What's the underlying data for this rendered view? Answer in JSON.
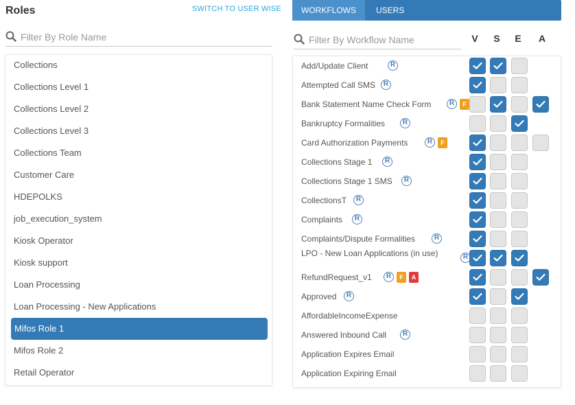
{
  "roles_panel": {
    "title": "Roles",
    "switch_label": "SWITCH TO USER WISE",
    "filter_placeholder": "Filter By Role Name",
    "items": [
      {
        "label": "Collections",
        "selected": false
      },
      {
        "label": "Collections Level 1",
        "selected": false
      },
      {
        "label": "Collections Level 2",
        "selected": false
      },
      {
        "label": "Collections Level 3",
        "selected": false
      },
      {
        "label": "Collections Team",
        "selected": false
      },
      {
        "label": "Customer Care",
        "selected": false
      },
      {
        "label": "HDEPOLKS",
        "selected": false
      },
      {
        "label": "job_execution_system",
        "selected": false
      },
      {
        "label": "Kiosk Operator",
        "selected": false
      },
      {
        "label": "Kiosk support",
        "selected": false
      },
      {
        "label": "Loan Processing",
        "selected": false
      },
      {
        "label": "Loan Processing - New Applications",
        "selected": false
      },
      {
        "label": "Mifos Role 1",
        "selected": true
      },
      {
        "label": "Mifos Role 2",
        "selected": false
      },
      {
        "label": "Retail Operator",
        "selected": false
      }
    ]
  },
  "workflow_panel": {
    "tabs": [
      {
        "label": "WORKFLOWS",
        "active": true
      },
      {
        "label": "USERS",
        "active": false
      }
    ],
    "filter_placeholder": "Filter By Workflow Name",
    "columns": [
      "V",
      "S",
      "E",
      "A"
    ],
    "r_icon_label": "R",
    "badge_f_label": "F",
    "badge_a_label": "A",
    "colors": {
      "accent": "#337ab7",
      "badge_f": "#f0a020",
      "badge_a": "#e03c3c"
    },
    "rows": [
      {
        "name": "Add/Update Client",
        "r": true,
        "badges": [],
        "checks": [
          true,
          true,
          false
        ],
        "a": null
      },
      {
        "name": "Attempted Call SMS",
        "r": true,
        "badges": [],
        "checks": [
          true,
          false,
          false
        ],
        "a": null
      },
      {
        "name": "Bank Statement Name Check Form",
        "r": true,
        "badges": [
          "F"
        ],
        "checks": [
          false,
          true,
          false
        ],
        "a": true
      },
      {
        "name": "Bankruptcy Formalities",
        "r": true,
        "badges": [],
        "checks": [
          false,
          false,
          true
        ],
        "a": null
      },
      {
        "name": "Card Authorization Payments",
        "r": true,
        "badges": [
          "F"
        ],
        "checks": [
          true,
          false,
          false
        ],
        "a": false
      },
      {
        "name": "Collections Stage 1",
        "r": true,
        "badges": [],
        "checks": [
          true,
          false,
          false
        ],
        "a": null
      },
      {
        "name": "Collections Stage 1 SMS",
        "r": true,
        "badges": [],
        "checks": [
          true,
          false,
          false
        ],
        "a": null
      },
      {
        "name": "CollectionsT",
        "r": true,
        "badges": [],
        "checks": [
          true,
          false,
          false
        ],
        "a": null
      },
      {
        "name": "Complaints",
        "r": true,
        "badges": [],
        "checks": [
          true,
          false,
          false
        ],
        "a": null
      },
      {
        "name": "Complaints/Dispute Formalities",
        "r": true,
        "badges": [],
        "checks": [
          true,
          false,
          false
        ],
        "a": null
      },
      {
        "name": "LPO - New Loan Applications (in use)",
        "r": true,
        "badges": [],
        "checks": [
          true,
          true,
          true
        ],
        "a": null
      },
      {
        "name": "RefundRequest_v1",
        "r": true,
        "badges": [
          "F",
          "A"
        ],
        "checks": [
          true,
          false,
          false
        ],
        "a": true
      },
      {
        "name": "Approved",
        "r": true,
        "badges": [],
        "checks": [
          true,
          false,
          true
        ],
        "a": null
      },
      {
        "name": "AffordableIncomeExpense",
        "r": false,
        "badges": [],
        "checks": [
          false,
          false,
          false
        ],
        "a": null
      },
      {
        "name": "Answered Inbound Call",
        "r": true,
        "badges": [],
        "checks": [
          false,
          false,
          false
        ],
        "a": null
      },
      {
        "name": "Application Expires Email",
        "r": false,
        "badges": [],
        "checks": [
          false,
          false,
          false
        ],
        "a": null
      },
      {
        "name": "Application Expiring Email",
        "r": false,
        "badges": [],
        "checks": [
          false,
          false,
          false
        ],
        "a": null
      }
    ]
  }
}
